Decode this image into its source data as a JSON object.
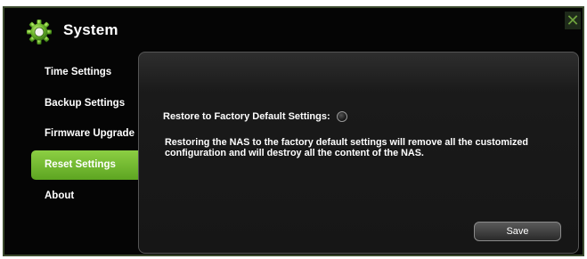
{
  "window": {
    "title": "System",
    "close_label": "✕"
  },
  "sidebar": {
    "items": [
      {
        "label": "Time Settings",
        "active": false
      },
      {
        "label": "Backup Settings",
        "active": false
      },
      {
        "label": "Firmware Upgrade",
        "active": false
      },
      {
        "label": "Reset Settings",
        "active": true
      },
      {
        "label": "About",
        "active": false
      }
    ]
  },
  "main": {
    "restore_label": "Restore to Factory Default Settings:",
    "restore_selected": false,
    "warning_text": "Restoring the NAS to the factory default settings will remove all the customized configuration and will destroy all the content of the NAS.",
    "save_label": "Save"
  },
  "colors": {
    "accent_green": "#6fbf2f",
    "background": "#050505",
    "panel": "#1a1a1a"
  },
  "icons": {
    "title_icon": "gear-icon",
    "close_icon": "close-icon"
  }
}
